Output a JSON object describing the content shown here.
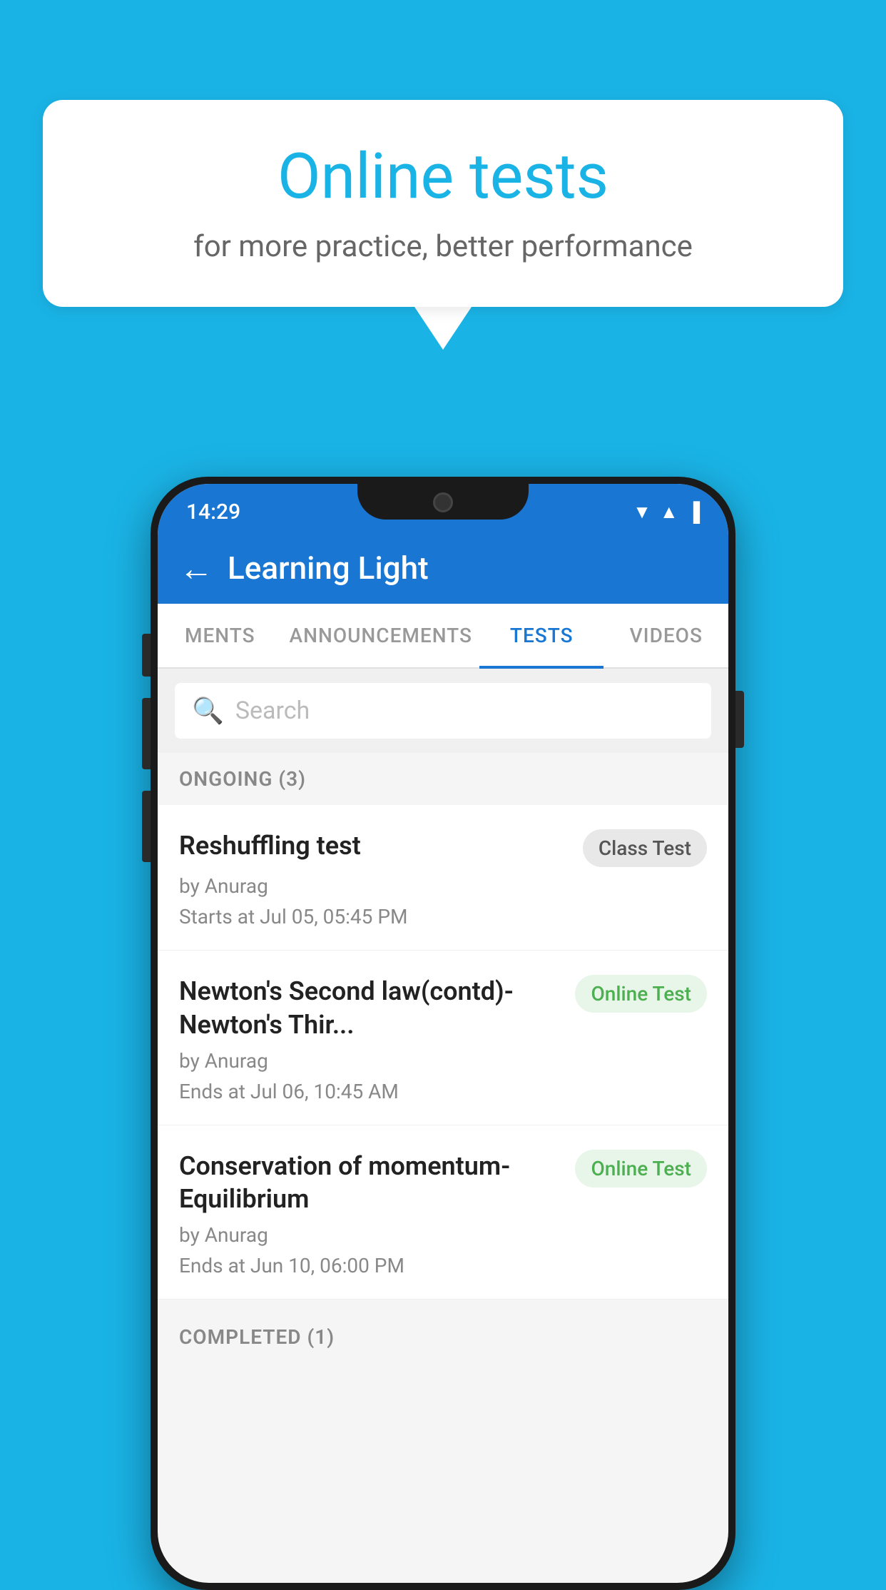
{
  "background": {
    "color": "#1AB3E6"
  },
  "speech_bubble": {
    "title": "Online tests",
    "subtitle": "for more practice, better performance"
  },
  "phone": {
    "status_bar": {
      "time": "14:29",
      "icons": [
        "▼",
        "▲",
        "▐"
      ]
    },
    "header": {
      "back_label": "←",
      "title": "Learning Light"
    },
    "tabs": [
      {
        "label": "MENTS",
        "active": false
      },
      {
        "label": "ANNOUNCEMENTS",
        "active": false
      },
      {
        "label": "TESTS",
        "active": true
      },
      {
        "label": "VIDEOS",
        "active": false
      }
    ],
    "search": {
      "placeholder": "Search"
    },
    "ongoing_section": {
      "header": "ONGOING (3)",
      "items": [
        {
          "name": "Reshuffling test",
          "badge": "Class Test",
          "badge_type": "class",
          "author": "by Anurag",
          "date": "Starts at  Jul 05, 05:45 PM"
        },
        {
          "name": "Newton's Second law(contd)-Newton's Thir...",
          "badge": "Online Test",
          "badge_type": "online",
          "author": "by Anurag",
          "date": "Ends at  Jul 06, 10:45 AM"
        },
        {
          "name": "Conservation of momentum-Equilibrium",
          "badge": "Online Test",
          "badge_type": "online",
          "author": "by Anurag",
          "date": "Ends at  Jun 10, 06:00 PM"
        }
      ]
    },
    "completed_section": {
      "header": "COMPLETED (1)"
    }
  }
}
